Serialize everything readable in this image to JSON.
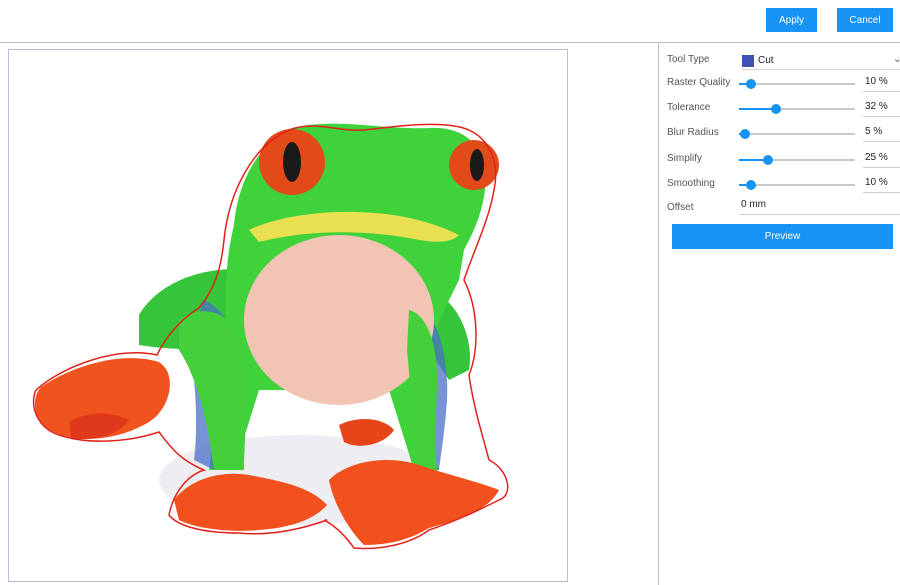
{
  "toolbar": {
    "apply_label": "Apply",
    "cancel_label": "Cancel"
  },
  "canvas": {
    "image_icon": "frog-photo",
    "cut_line_color": "#e0221d"
  },
  "panel": {
    "tool_type": {
      "label": "Tool Type",
      "value": "Cut",
      "swatch_color": "#3f51b5"
    },
    "raster_quality": {
      "label": "Raster Quality",
      "value_text": "10 %",
      "value": 10
    },
    "tolerance": {
      "label": "Tolerance",
      "value_text": "32 %",
      "value": 32
    },
    "blur_radius": {
      "label": "Blur Radius",
      "value_text": "5 %",
      "value": 5
    },
    "simplify": {
      "label": "Simplify",
      "value_text": "25 %",
      "value": 25
    },
    "smoothing": {
      "label": "Smoothing",
      "value_text": "10 %",
      "value": 10
    },
    "offset": {
      "label": "Offset",
      "value_text": "0 mm"
    },
    "preview_label": "Preview"
  },
  "colors": {
    "accent": "#1793f5"
  }
}
